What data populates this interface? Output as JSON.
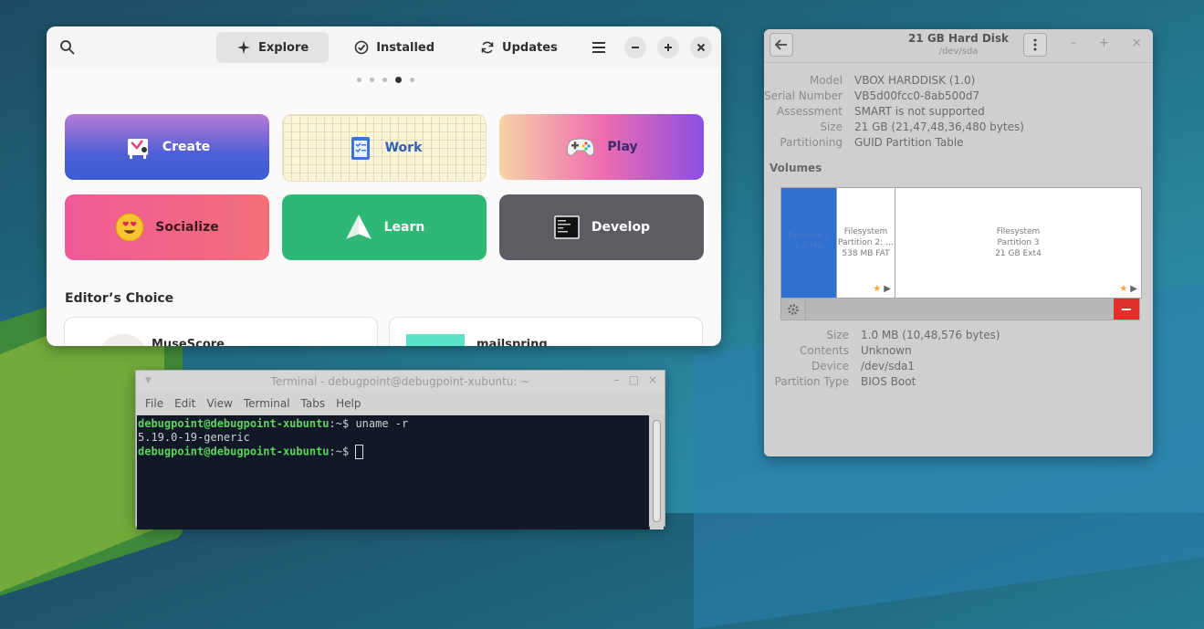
{
  "software": {
    "tabs": [
      {
        "label": "Explore",
        "icon": "explore-icon",
        "active": true
      },
      {
        "label": "Installed",
        "icon": "check-circle-icon",
        "active": false
      },
      {
        "label": "Updates",
        "icon": "refresh-icon",
        "active": false
      }
    ],
    "page_dots": 5,
    "active_dot": 4,
    "categories": [
      {
        "label": "Create",
        "icon": "create-icon"
      },
      {
        "label": "Work",
        "icon": "clipboard-icon"
      },
      {
        "label": "Play",
        "icon": "gamepad-icon"
      },
      {
        "label": "Socialize",
        "icon": "heart-eyes-emoji-icon"
      },
      {
        "label": "Learn",
        "icon": "paper-plane-icon"
      },
      {
        "label": "Develop",
        "icon": "terminal-icon"
      }
    ],
    "editors_choice_label": "Editor’s Choice",
    "apps": [
      {
        "name": "MuseScore"
      },
      {
        "name": "mailspring"
      }
    ]
  },
  "disks": {
    "title": "21 GB Hard Disk",
    "subtitle": "/dev/sda",
    "info": [
      {
        "key": "Model",
        "value": "VBOX HARDDISK (1.0)"
      },
      {
        "key": "Serial Number",
        "value": "VB5d00fcc0-8ab500d7"
      },
      {
        "key": "Assessment",
        "value": "SMART is not supported"
      },
      {
        "key": "Size",
        "value": "21 GB (21,47,48,36,480 bytes)"
      },
      {
        "key": "Partitioning",
        "value": "GUID Partition Table"
      }
    ],
    "volumes_label": "Volumes",
    "partitions": [
      {
        "line1": "Partition 1",
        "line2": "1.0 MB"
      },
      {
        "line1": "Filesystem",
        "line2": "Partition 2: …",
        "line3": "538 MB FAT"
      },
      {
        "line1": "Filesystem",
        "line2": "Partition 3",
        "line3": "21 GB Ext4"
      }
    ],
    "partition_info": [
      {
        "key": "Size",
        "value": "1.0 MB (10,48,576 bytes)"
      },
      {
        "key": "Contents",
        "value": "Unknown"
      },
      {
        "key": "Device",
        "value": "/dev/sda1"
      },
      {
        "key": "Partition Type",
        "value": "BIOS Boot"
      }
    ]
  },
  "terminal": {
    "title": "Terminal - debugpoint@debugpoint-xubuntu: ~",
    "menu": [
      "File",
      "Edit",
      "View",
      "Terminal",
      "Tabs",
      "Help"
    ],
    "prompt_user": "debugpoint@debugpoint-xubuntu",
    "prompt_path": ":~$",
    "command": "uname -r",
    "output": "5.19.0-19-generic"
  }
}
